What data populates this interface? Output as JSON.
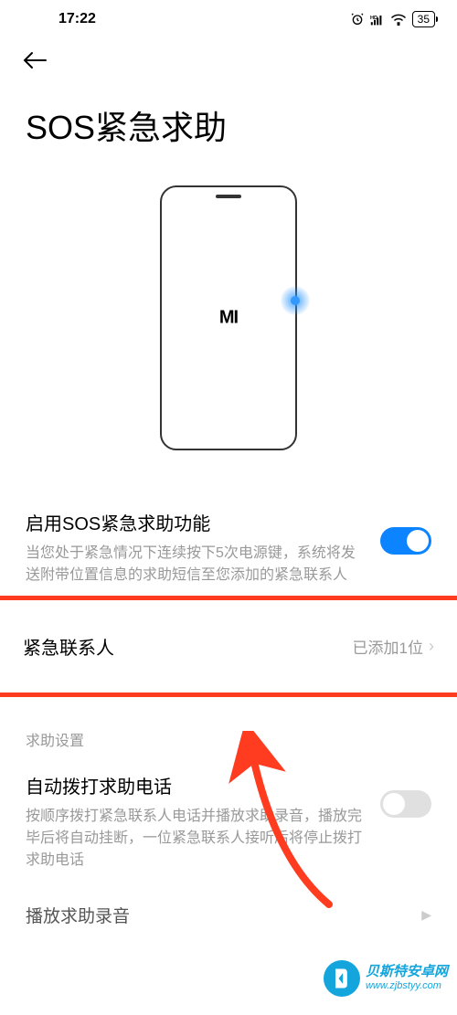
{
  "status_bar": {
    "time": "17:22",
    "battery_level": "35"
  },
  "page": {
    "title": "SOS紧急求助",
    "phone_logo": "MI"
  },
  "sos_enable": {
    "title": "启用SOS紧急求助功能",
    "description": "当您处于紧急情况下连续按下5次电源键，系统将发送附带位置信息的求助短信至您添加的紧急联系人"
  },
  "emergency_contact": {
    "label": "紧急联系人",
    "value": "已添加1位"
  },
  "help_settings": {
    "header": "求助设置",
    "auto_call": {
      "title": "自动拨打求助电话",
      "description": "按顺序拨打紧急联系人电话并播放求助录音，播放完毕后将自动挂断，一位紧急联系人接听后将停止拨打求助电话"
    },
    "play_recording": {
      "label": "播放求助录音"
    }
  },
  "watermark": {
    "title": "贝斯特安卓网",
    "url": "www.zjbstyy.com"
  }
}
